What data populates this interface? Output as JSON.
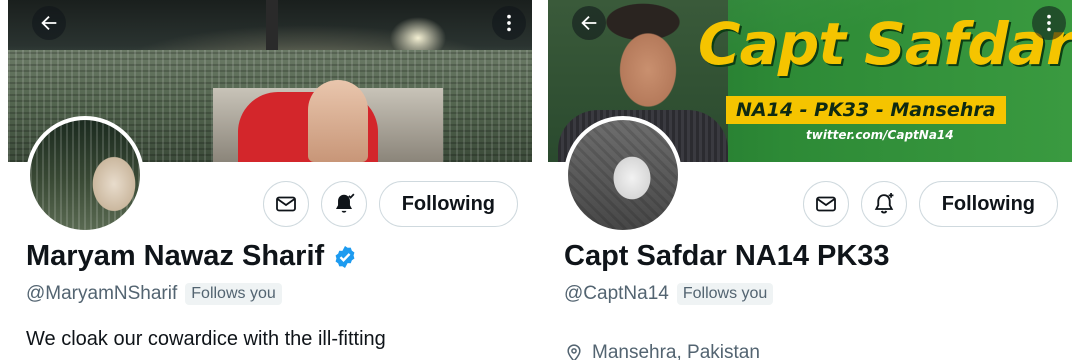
{
  "profiles": [
    {
      "name": "Maryam Nawaz Sharif",
      "verified": true,
      "handle": "@MaryamNSharif",
      "follows_you": "Follows you",
      "following_label": "Following",
      "bio_visible": "We cloak our cowardice with the ill-fitting",
      "notification_icon": "bell-check-icon",
      "banner_theme": "rally"
    },
    {
      "name": "Capt Safdar NA14 PK33",
      "verified": false,
      "handle": "@CaptNa14",
      "follows_you": "Follows you",
      "following_label": "Following",
      "location": "Mansehra, Pakistan",
      "notification_icon": "bell-plus-icon",
      "banner": {
        "title": "Capt Safdar",
        "constituency": "NA14 - PK33 - Mansehra",
        "url": "twitter.com/CaptNa14"
      }
    }
  ],
  "colors": {
    "verified_blue": "#1d9bf0",
    "banner_green": "#2d8a36",
    "banner_yellow": "#f5c400",
    "text_secondary": "#536471"
  }
}
